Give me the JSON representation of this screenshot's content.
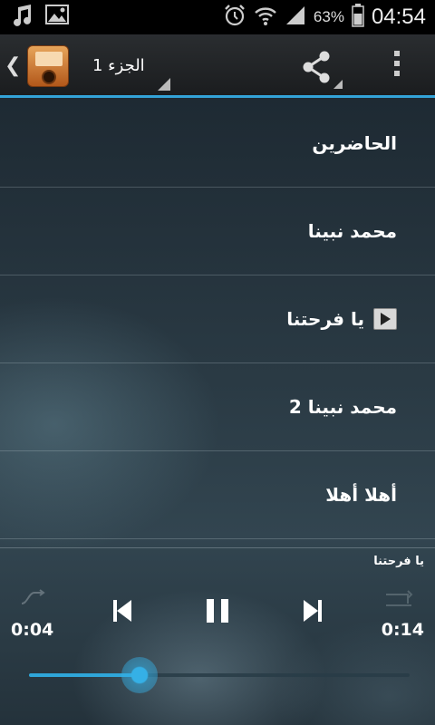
{
  "status_bar": {
    "battery_percent": "63%",
    "time": "04:54",
    "icons": [
      "music-note-icon",
      "image-icon",
      "alarm-icon",
      "wifi-icon",
      "signal-icon",
      "battery-icon"
    ]
  },
  "action_bar": {
    "spinner_label": "الجزء 1",
    "accent_color": "#33a3d8",
    "icons": [
      "back-chevron-icon",
      "app-radio-icon",
      "share-icon",
      "overflow-menu-icon"
    ]
  },
  "tracks": [
    {
      "title": "الحاضرين",
      "playing": false
    },
    {
      "title": "محمد نبينا",
      "playing": false
    },
    {
      "title": "يا فرحتنا",
      "playing": true
    },
    {
      "title": "محمد نبينا 2",
      "playing": false
    },
    {
      "title": "أهلا أهلا",
      "playing": false
    }
  ],
  "player": {
    "now_playing": "يا فرحتنا",
    "elapsed": "0:04",
    "duration": "0:14",
    "progress_fraction": 0.29,
    "seek_color": "#2fa6d9",
    "icons": [
      "previous-icon",
      "pause-icon",
      "next-icon"
    ]
  }
}
